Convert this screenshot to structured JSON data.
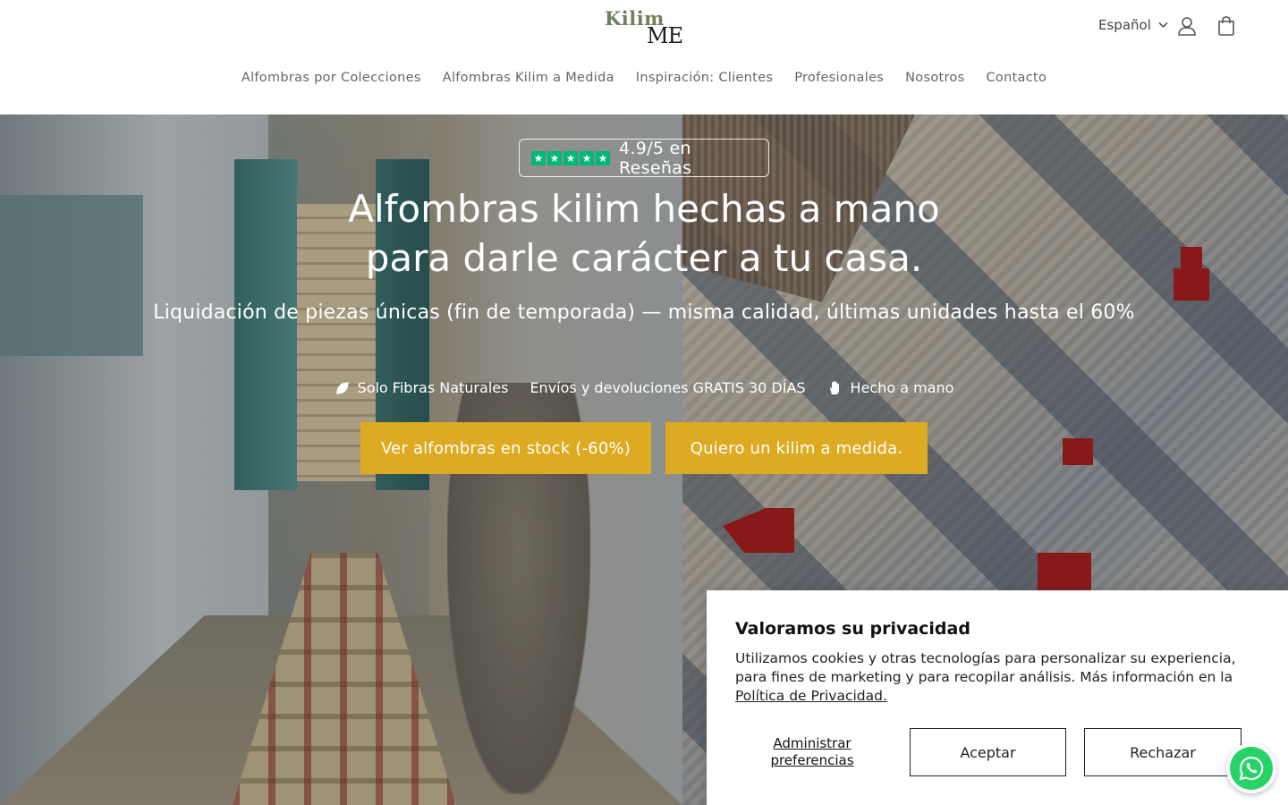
{
  "header": {
    "logo": {
      "line1": "Kilim",
      "line2": "ME"
    },
    "language": "Español",
    "nav": [
      "Alfombras por Colecciones",
      "Alfombras Kilim a Medida",
      "Inspiración: Clientes",
      "Profesionales",
      "Nosotros",
      "Contacto"
    ]
  },
  "hero": {
    "rating": "4.9/5 en Reseñas",
    "title_line1": "Alfombras kilim hechas a mano",
    "title_line2": "para darle carácter a tu casa.",
    "subtitle": "Liquidación de piezas únicas (fin de temporada) — misma calidad, últimas unidades hasta el 60%",
    "features": {
      "natural": "Solo Fibras Naturales",
      "shipping": "Envíos y devoluciones GRATIS 30 DÍAS",
      "handmade": "Hecho a mano"
    },
    "buttons": {
      "stock": "Ver alfombras en stock (-60%)",
      "custom": "Quiero un kilim a medida."
    }
  },
  "cookie": {
    "title": "Valoramos su privacidad",
    "text": "Utilizamos cookies y otras tecnologías para personalizar su experiencia, para fines de marketing y para recopilar análisis. Más información en la ",
    "link": "Política de Privacidad.",
    "manage": "Administrar preferencias",
    "accept": "Aceptar",
    "reject": "Rechazar"
  },
  "colors": {
    "accent_button": "#deaa22",
    "trustpilot_green": "#00b67a",
    "whatsapp_green": "#25d366",
    "logo_green": "#6f7f5b"
  },
  "icons": [
    "account-icon",
    "cart-icon",
    "chevron-down-icon",
    "leaf-icon",
    "hand-icon",
    "star-icon",
    "whatsapp-icon"
  ]
}
